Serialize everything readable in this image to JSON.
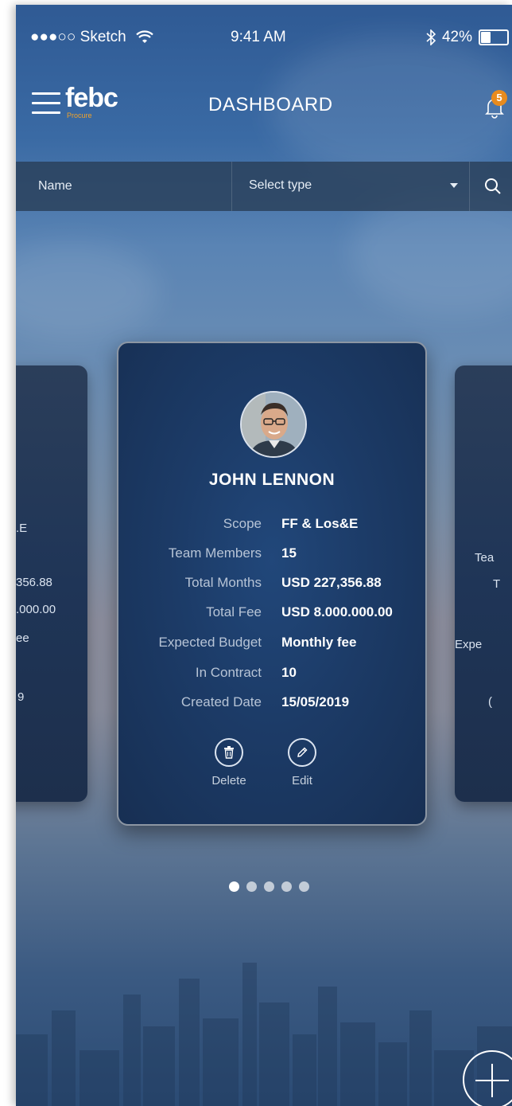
{
  "status_bar": {
    "carrier": "●●●○○ Sketch",
    "time": "9:41 AM",
    "battery": "42%",
    "battery_level": 0.42
  },
  "header": {
    "logo": "febc",
    "logo_sub": "Procure",
    "title": "DASHBOARD",
    "notification_count": "5"
  },
  "search": {
    "name_placeholder": "Name",
    "select_type": "Select type"
  },
  "left_card_partial": {
    "lines": [
      ".E",
      "356.88",
      ".000.00",
      "ee",
      "9"
    ]
  },
  "card": {
    "name": "JOHN LENNON",
    "fields": [
      {
        "label": "Scope",
        "value": "FF & Los&E"
      },
      {
        "label": "Team Members",
        "value": "15"
      },
      {
        "label": "Total Months",
        "value": "USD 227,356.88"
      },
      {
        "label": "Total Fee",
        "value": "USD 8.000.000.00"
      },
      {
        "label": "Expected Budget",
        "value": "Monthly fee"
      },
      {
        "label": "In Contract",
        "value": "10"
      },
      {
        "label": "Created Date",
        "value": "15/05/2019"
      }
    ],
    "delete_label": "Delete",
    "edit_label": "Edit"
  },
  "right_card_partial": {
    "lines": [
      "Tea",
      "T",
      "Expe",
      "("
    ]
  },
  "pagination": {
    "count": 5,
    "active": 0
  },
  "colors": {
    "accent": "#e88b1e",
    "card_bg": "#1c3b67"
  }
}
